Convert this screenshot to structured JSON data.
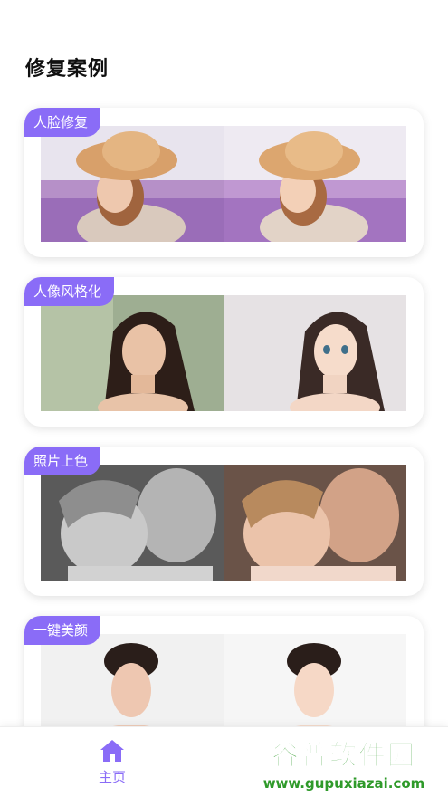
{
  "page": {
    "title": "修复案例"
  },
  "cases": [
    {
      "label": "人脸修复"
    },
    {
      "label": "人像风格化"
    },
    {
      "label": "照片上色"
    },
    {
      "label": "一键美颜"
    }
  ],
  "tabbar": {
    "home_label": "主页"
  },
  "watermark": {
    "brand": "谷普软件园",
    "url": "www.gupuxiazai.com"
  },
  "colors": {
    "accent": "#8a6cf7",
    "background": "#ffffff"
  }
}
